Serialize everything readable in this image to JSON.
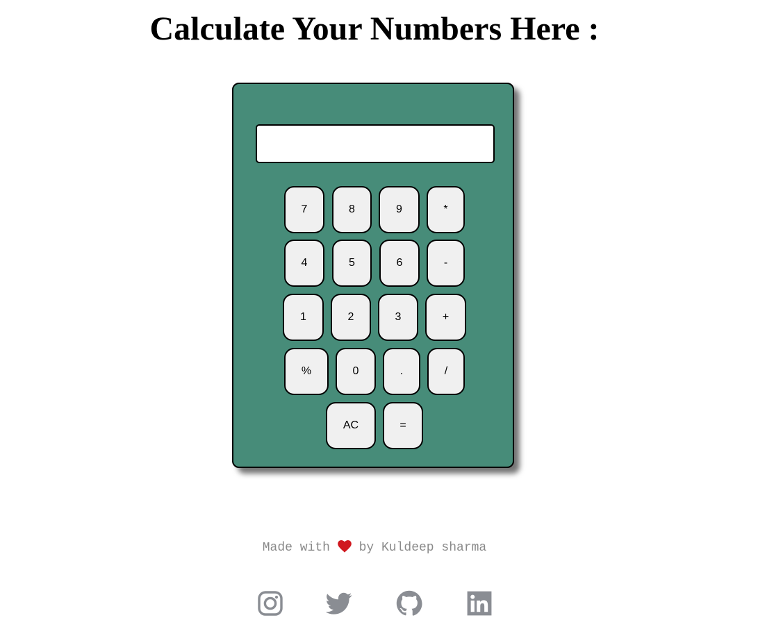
{
  "page": {
    "title": "Calculate Your Numbers Here :"
  },
  "calculator": {
    "display_value": "",
    "keys": {
      "k7": "7",
      "k8": "8",
      "k9": "9",
      "mul": "*",
      "k4": "4",
      "k5": "5",
      "k6": "6",
      "sub": "-",
      "k1": "1",
      "k2": "2",
      "k3": "3",
      "add": "+",
      "pct": "%",
      "k0": "0",
      "dot": ".",
      "div": "/",
      "ac": "AC",
      "eq": "="
    }
  },
  "footer": {
    "made_with": "Made with",
    "by": "by Kuldeep sharma",
    "heart_icon": "heart-icon",
    "heart_color": "#d0181f",
    "icon_color": "#8a8d93",
    "socials": [
      "instagram-icon",
      "twitter-icon",
      "github-icon",
      "linkedin-icon"
    ]
  },
  "colors": {
    "calculator_body": "#478c79",
    "key_background": "#f0f0f0"
  }
}
